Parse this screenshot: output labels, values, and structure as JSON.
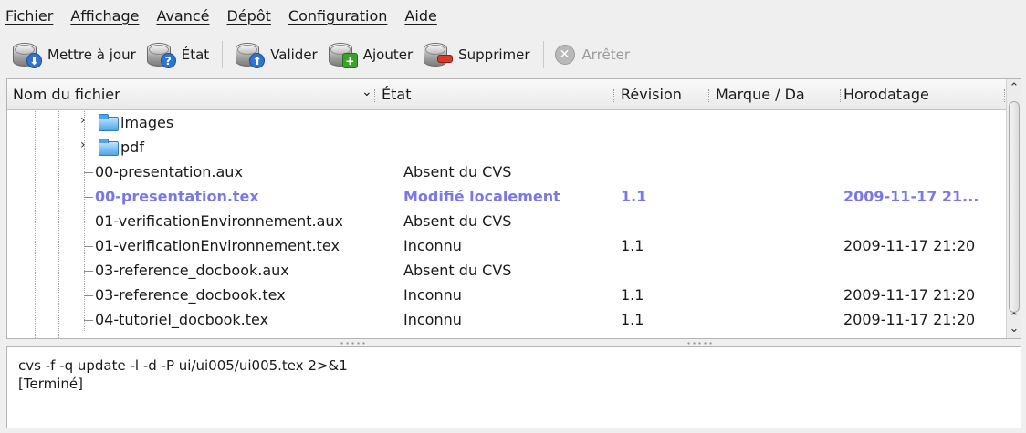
{
  "menu": [
    "Fichier",
    "Affichage",
    "Avancé",
    "Dépôt",
    "Configuration",
    "Aide"
  ],
  "toolbar": {
    "update": {
      "label": "Mettre à jour",
      "icon": "db-update-icon"
    },
    "status": {
      "label": "État",
      "icon": "db-status-icon"
    },
    "commit": {
      "label": "Valider",
      "icon": "db-commit-icon"
    },
    "add": {
      "label": "Ajouter",
      "icon": "db-add-icon"
    },
    "remove": {
      "label": "Supprimer",
      "icon": "db-remove-icon"
    },
    "stop": {
      "label": "Arrêter",
      "icon": "stop-icon"
    }
  },
  "columns": {
    "name": "Nom du fichier",
    "state": "État",
    "revision": "Révision",
    "tag": "Marque  /  Da",
    "timestamp": "Horodatage"
  },
  "rows": [
    {
      "type": "folder",
      "name": "images",
      "state": "",
      "revision": "",
      "timestamp": ""
    },
    {
      "type": "folder",
      "name": "pdf",
      "state": "",
      "revision": "",
      "timestamp": ""
    },
    {
      "type": "file",
      "name": "00-presentation.aux",
      "state": "Absent du CVS",
      "revision": "",
      "timestamp": ""
    },
    {
      "type": "file",
      "name": "00-presentation.tex",
      "state": "Modifié localement",
      "revision": "1.1",
      "timestamp": "2009-11-17 21...",
      "modified": true
    },
    {
      "type": "file",
      "name": "01-verificationEnvironnement.aux",
      "state": "Absent du CVS",
      "revision": "",
      "timestamp": ""
    },
    {
      "type": "file",
      "name": "01-verificationEnvironnement.tex",
      "state": "Inconnu",
      "revision": "1.1",
      "timestamp": "2009-11-17 21:20"
    },
    {
      "type": "file",
      "name": "03-reference_docbook.aux",
      "state": "Absent du CVS",
      "revision": "",
      "timestamp": ""
    },
    {
      "type": "file",
      "name": "03-reference_docbook.tex",
      "state": "Inconnu",
      "revision": "1.1",
      "timestamp": "2009-11-17 21:20"
    },
    {
      "type": "file",
      "name": "04-tutoriel_docbook.tex",
      "state": "Inconnu",
      "revision": "1.1",
      "timestamp": "2009-11-17 21:20"
    }
  ],
  "output": {
    "command": "cvs -f -q update -l -d -P ui/ui005/ui005.tex 2>&1",
    "result": "[Terminé]"
  }
}
